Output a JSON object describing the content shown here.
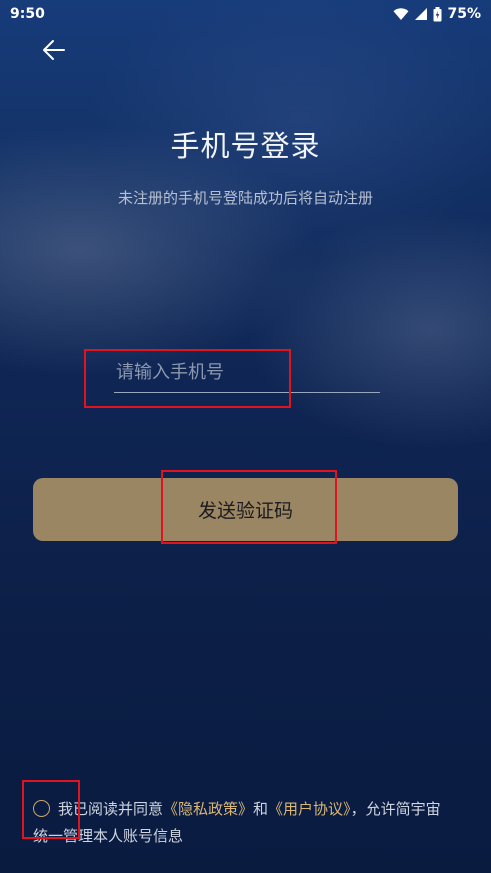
{
  "status_bar": {
    "time": "9:50",
    "battery": "75%",
    "icons": [
      "wifi-icon",
      "signal-icon",
      "battery-icon"
    ]
  },
  "nav": {
    "back_icon": "arrow-left-icon"
  },
  "login": {
    "title": "手机号登录",
    "subtitle": "未注册的手机号登陆成功后将自动注册",
    "phone_placeholder": "请输入手机号",
    "phone_value": "",
    "send_code_label": "发送验证码"
  },
  "agreement": {
    "text_before": "我已阅读并同意",
    "privacy_link": "《隐私政策》",
    "and": "和",
    "user_link": "《用户协议》",
    "text_after": "，允许简宇宙统一管理本人账号信息",
    "checked": false
  },
  "colors": {
    "background": "#0e2146",
    "button": "#9b8663",
    "link": "#d8b777",
    "highlight_box": "#e0141e"
  }
}
